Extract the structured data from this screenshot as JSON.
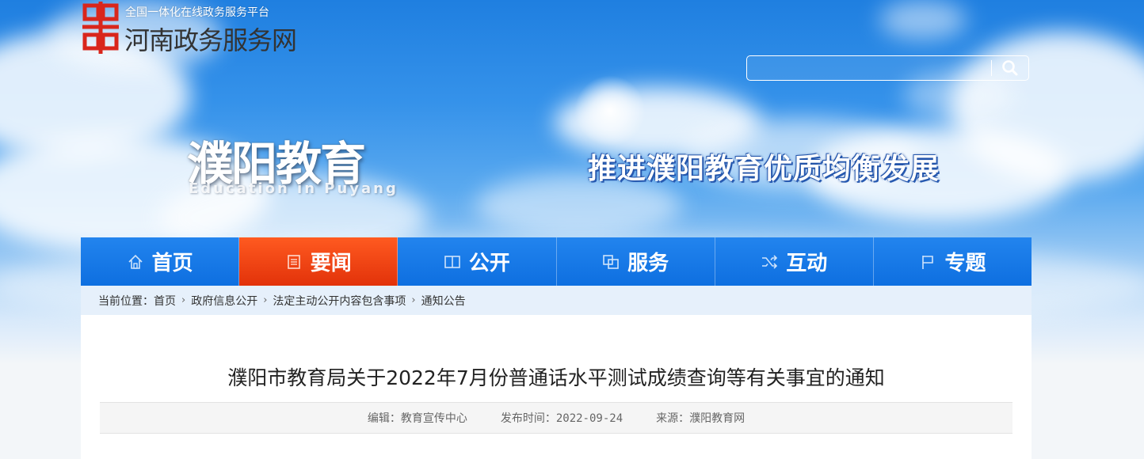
{
  "header": {
    "logo_small": "全国一体化在线政务服务平台",
    "logo_big": "河南政务服务网",
    "search_placeholder": ""
  },
  "banner": {
    "site_title": "濮阳教育",
    "site_subtitle": "Education in Puyang",
    "slogan": "推进濮阳教育优质均衡发展"
  },
  "nav": {
    "items": [
      {
        "label": "首页",
        "icon": "home-icon"
      },
      {
        "label": "要闻",
        "icon": "news-list-icon"
      },
      {
        "label": "公开",
        "icon": "open-book-icon"
      },
      {
        "label": "服务",
        "icon": "service-icon"
      },
      {
        "label": "互动",
        "icon": "shuffle-icon"
      },
      {
        "label": "专题",
        "icon": "flag-icon"
      }
    ],
    "active_index": 1
  },
  "breadcrumb": {
    "prefix": "当前位置：",
    "items": [
      "首页",
      "政府信息公开",
      "法定主动公开内容包含事项",
      "通知公告"
    ]
  },
  "article": {
    "title": "濮阳市教育局关于2022年7月份普通话水平测试成绩查询等有关事宜的通知",
    "editor_label": "编辑：",
    "editor": "教育宣传中心",
    "date_label": "发布时间：",
    "date": "2022-09-24",
    "source_label": "来源：",
    "source": "濮阳教育网"
  },
  "colors": {
    "nav_blue": "#1479e8",
    "nav_active": "#ef3f12",
    "logo_red": "#d9261c"
  }
}
